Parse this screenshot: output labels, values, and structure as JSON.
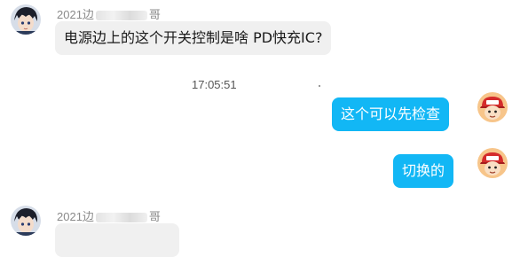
{
  "messages": [
    {
      "side": "incoming",
      "sender_prefix": "2021边",
      "sender_suffix": "哥",
      "text": "电源边上的这个开关控制是啥 PD快充IC?"
    },
    {
      "side": "outgoing",
      "text": "这个可以先检查"
    },
    {
      "side": "outgoing",
      "text": "切换的"
    },
    {
      "side": "incoming",
      "sender_prefix": "2021边",
      "sender_suffix": "哥",
      "text": ""
    }
  ],
  "timestamp": "17:05:51",
  "colors": {
    "incoming_bubble": "#f0f0f0",
    "outgoing_bubble": "#12b7f5",
    "sender_text": "#8a8a8a"
  },
  "icons": {
    "contact_avatar": "anime-boy-avatar-icon",
    "self_avatar": "cartoon-boy-red-cap-avatar-icon"
  }
}
